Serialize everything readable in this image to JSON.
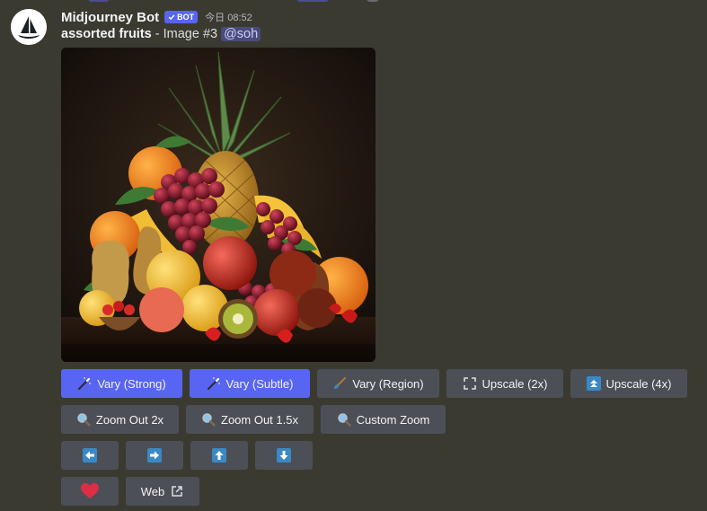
{
  "message": {
    "author": "Midjourney Bot",
    "bot_badge": "BOT",
    "timestamp": "今日 08:52",
    "prompt": "assorted fruits",
    "suffix": " - Image #3",
    "mention": "@soh"
  },
  "image": {
    "subject": "still life of assorted fruits: pineapple, grapes, bananas, apples, pears, kiwi, strawberries, oranges"
  },
  "buttons": {
    "row1": [
      {
        "label": "Vary (Strong)",
        "icon": "magic-wand-icon",
        "style": "primary"
      },
      {
        "label": "Vary (Subtle)",
        "icon": "magic-wand-icon",
        "style": "primary"
      },
      {
        "label": "Vary (Region)",
        "icon": "paintbrush-icon",
        "style": "secondary"
      },
      {
        "label": "Upscale (2x)",
        "icon": "expand-icon",
        "style": "secondary"
      },
      {
        "label": "Upscale (4x)",
        "icon": "double-up-icon",
        "style": "secondary"
      }
    ],
    "row2": [
      {
        "label": "Zoom Out 2x",
        "icon": "magnifier-icon"
      },
      {
        "label": "Zoom Out 1.5x",
        "icon": "magnifier-icon"
      },
      {
        "label": "Custom Zoom",
        "icon": "magnifier-icon"
      }
    ],
    "row3": [
      {
        "icon": "arrow-left-icon"
      },
      {
        "icon": "arrow-right-icon"
      },
      {
        "icon": "arrow-up-icon"
      },
      {
        "icon": "arrow-down-icon"
      }
    ],
    "row4": [
      {
        "icon": "heart-icon"
      },
      {
        "label": "Web",
        "icon": "external-link-icon"
      }
    ]
  },
  "colors": {
    "background": "#3b3a31",
    "primary_button": "#5865f2",
    "secondary_button": "#4d4f56",
    "arrow_blue": "#3b88c3",
    "heart_red": "#dd2e44"
  }
}
